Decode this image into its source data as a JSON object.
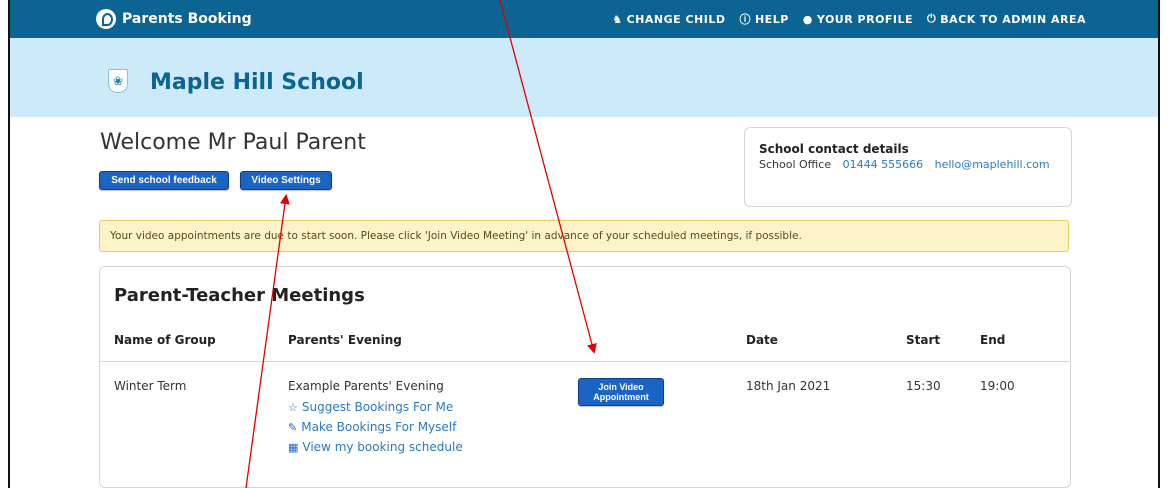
{
  "header": {
    "brand": "Parents Booking",
    "nav": [
      {
        "label": "CHANGE CHILD",
        "icon": "users-icon"
      },
      {
        "label": "HELP",
        "icon": "help-icon"
      },
      {
        "label": "YOUR PROFILE",
        "icon": "user-icon"
      },
      {
        "label": "BACK TO ADMIN AREA",
        "icon": "power-icon"
      }
    ]
  },
  "school": {
    "name": "Maple Hill School"
  },
  "welcome": {
    "text": "Welcome Mr Paul Parent"
  },
  "buttons": {
    "feedback": "Send school feedback",
    "video_settings": "Video Settings"
  },
  "contact": {
    "title": "School contact details",
    "office_label": "School Office",
    "phone": "01444 555666",
    "email": "hello@maplehill.com"
  },
  "alert": {
    "text": "Your video appointments are due to start soon. Please click 'Join Video Meeting' in advance of your scheduled meetings, if possible."
  },
  "meetings": {
    "title": "Parent-Teacher Meetings",
    "columns": [
      "Name of Group",
      "Parents' Evening",
      "Date",
      "Start",
      "End"
    ],
    "row": {
      "group": "Winter Term",
      "evening": "Example Parents' Evening",
      "join_label": "Join Video Appointment",
      "date": "18th Jan 2021",
      "start": "15:30",
      "end": "19:00",
      "actions": [
        {
          "label": "Suggest Bookings For Me",
          "icon": "star-icon"
        },
        {
          "label": "Make Bookings For Myself",
          "icon": "pencil-icon"
        },
        {
          "label": "View my booking schedule",
          "icon": "calendar-icon"
        }
      ]
    }
  },
  "colors": {
    "topbar": "#0b6491",
    "school_band": "#cdeafa",
    "button": "#1b64c3",
    "link": "#2a7ac0",
    "alert_bg": "#fdf3c8",
    "annotation_arrow": "#e00000"
  }
}
